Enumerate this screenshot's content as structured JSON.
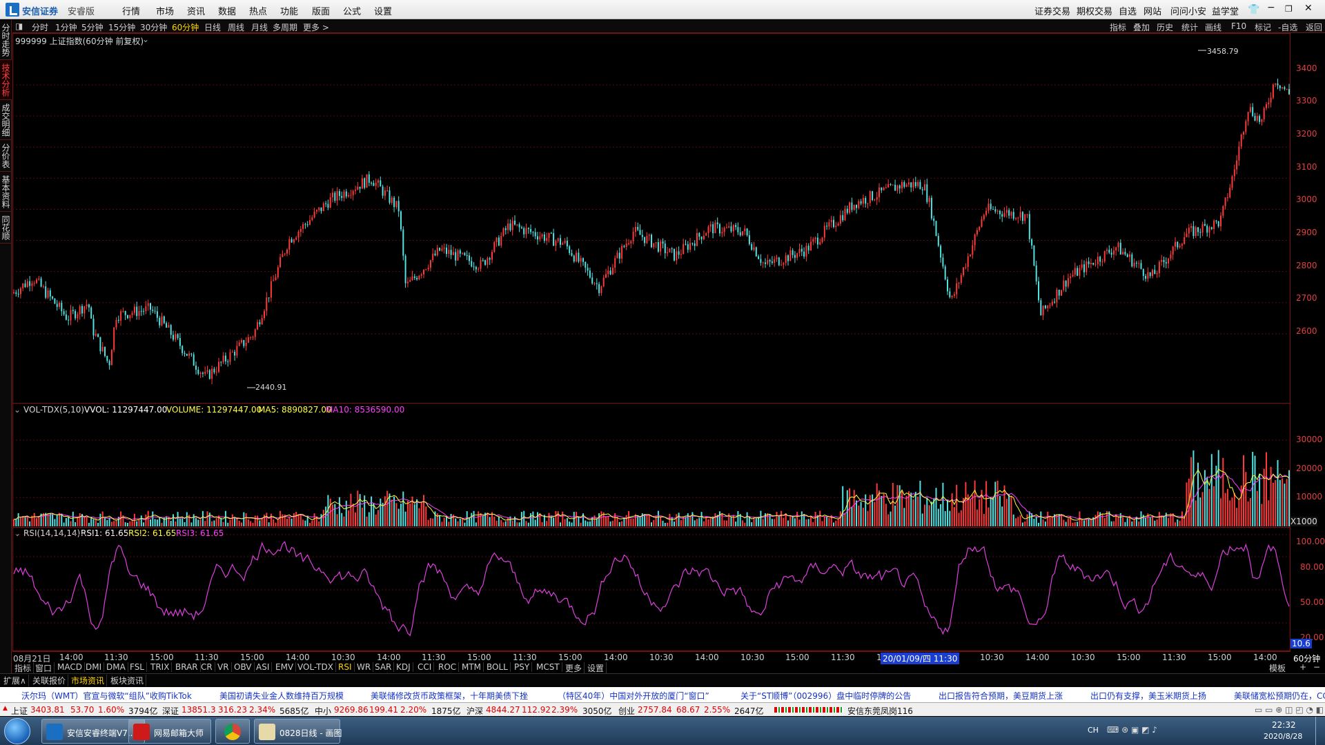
{
  "menubar": {
    "logo_text": "安信证券",
    "edition": "安睿版",
    "items": [
      "行情",
      "市场",
      "资讯",
      "数据",
      "热点",
      "功能",
      "版面",
      "公式",
      "设置"
    ],
    "right_items": [
      "证券交易",
      "期权交易",
      "自选",
      "网站",
      "问问小安",
      "益学堂"
    ]
  },
  "toolbar": {
    "periods": [
      "分时",
      "1分钟",
      "5分钟",
      "15分钟",
      "30分钟",
      "60分钟",
      "日线",
      "周线",
      "月线",
      "多周期",
      "更多 >"
    ],
    "active_period": "60分钟",
    "right_items": [
      "指标",
      "叠加",
      "历史",
      "统计",
      "画线",
      "F10",
      "标记",
      "-自选",
      "返回"
    ]
  },
  "sidebar": {
    "tabs": [
      "分时走势",
      "技术分析",
      "成交明细",
      "分价表",
      "基本资料",
      "同花顺"
    ],
    "active": "技术分析"
  },
  "main_chart": {
    "title": "999999 上证指数(60分钟 前复权)",
    "high_marker": "3458.79",
    "low_marker": "2440.91",
    "y_ticks": [
      "3400",
      "3300",
      "3200",
      "3100",
      "3000",
      "2900",
      "2800",
      "2700",
      "2600"
    ]
  },
  "volume_panel": {
    "title_name": "VOL-TDX(5,10)",
    "vvol": "VVOL: 11297447.00",
    "volume": "VOLUME: 11297447.00",
    "ma5": "MA5: 8890827.00",
    "ma10": "MA10: 8536590.00",
    "y_ticks": [
      "30000",
      "20000",
      "10000"
    ],
    "unit": "X1000",
    "colors": {
      "up": "#ff3a3a",
      "down": "#4fe3e3",
      "ma5": "#ffff40",
      "ma10": "#ff40ff"
    }
  },
  "rsi_panel": {
    "title_name": "RSI(14,14,14)",
    "rsi1": "RSI1: 61.65",
    "rsi2": "RSI2: 61.65",
    "rsi3": "RSI3: 61.65",
    "y_ticks": [
      "100.00",
      "80.00",
      "50.00",
      "20.00"
    ],
    "current_value": "10.6",
    "color": "#e040e0"
  },
  "x_axis": {
    "labels": [
      "08月21日",
      "14:00",
      "11:30",
      "15:00",
      "11:30",
      "15:00",
      "14:00",
      "10:30",
      "14:00",
      "11:30",
      "15:00",
      "11:30",
      "15:00",
      "14:00",
      "10:30",
      "14:00",
      "10:30",
      "15:00",
      "11:30",
      "1",
      "10:30",
      "14:00",
      "10:30",
      "15:00",
      "11:30",
      "15:00",
      "14:00"
    ],
    "cursor_label": "20/01/09/四 11:30",
    "period_label": "60分钟"
  },
  "indicator_tabs": [
    "指标",
    "窗口",
    "MACD",
    "DMI",
    "DMA",
    "FSL",
    "TRIX",
    "BRAR",
    "CR",
    "VR",
    "OBV",
    "ASI",
    "EMV",
    "VOL-TDX",
    "RSI",
    "WR",
    "SAR",
    "KDJ",
    "CCI",
    "ROC",
    "MTM",
    "BOLL",
    "PSY",
    "MCST",
    "更多",
    "设置"
  ],
  "active_indicator": "RSI",
  "template_label": "模板",
  "info_tabs": [
    "扩展∧",
    "关联报价",
    "市场资讯",
    "板块资讯"
  ],
  "ticker": [
    "沃尔玛（WMT）官宣与微软“组队”收购TikTok",
    "美国初请失业金人数维持百万规模",
    "美联储修改货币政策框架，十年期美债下挫",
    "（特区40年）中国对外开放的厦门“窗口”",
    "关于“ST顺博”（002996）盘中临时停牌的公告",
    "出口报告符合预期，美豆期货上涨",
    "出口仍有支撑，美玉米期货上扬",
    "美联储宽松预期仍在，CC"
  ],
  "indexbar": {
    "sh": {
      "name": "上证",
      "price": "3403.81",
      "change": "53.70",
      "pct": "1.60%",
      "amount": "3794亿"
    },
    "sz": {
      "name": "深证",
      "price": "13851.3",
      "change": "316.23",
      "pct": "2.34%",
      "amount": "5685亿"
    },
    "zx": {
      "name": "中小",
      "price": "9269.86",
      "change": "199.41",
      "pct": "2.20%",
      "amount": "1875亿"
    },
    "hs": {
      "name": "沪深",
      "price": "4844.27",
      "change": "112.92",
      "pct": "2.39%",
      "amount": "3050亿"
    },
    "cy": {
      "name": "创业",
      "price": "2757.84",
      "change": "68.67",
      "pct": "2.55%",
      "amount": "2647亿"
    },
    "broker": "安信东莞凤岗116"
  },
  "taskbar": {
    "apps": [
      "安信安睿终端V7...",
      "网易邮箱大师",
      "",
      "0828日线 - 画图"
    ],
    "lang": "CH",
    "time": "22:32",
    "date": "2020/8/28"
  }
}
